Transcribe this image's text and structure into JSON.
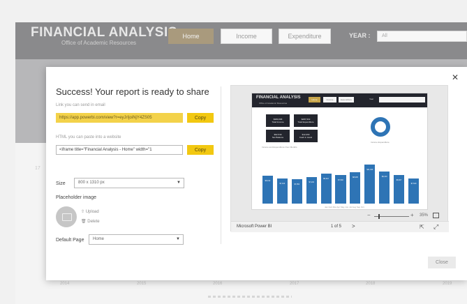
{
  "header": {
    "title": "FINANCIAL ANALYSIS",
    "subtitle": "Office of Academic Resources",
    "tabs": [
      "Home",
      "Income",
      "Expenditure"
    ],
    "year_label": "YEAR :",
    "year_value": "All"
  },
  "background": {
    "ticks": [
      "2014",
      "2015",
      "2016",
      "2017",
      "2018",
      "2019"
    ],
    "axis_label": "17"
  },
  "modal": {
    "title": "Success! Your report is ready to share",
    "link_hint": "Link you can send in email",
    "link_value": "https://app.powerbi.com/view?r=eyJrIjoiNjY4ZS05",
    "copy_label": "Copy",
    "embed_hint": "HTML you can paste into a website",
    "embed_value": "<iframe title=\"Financial Analysis - Home\" width=\"1",
    "size_label": "Size",
    "size_value": "800 x 1310 px",
    "placeholder_label": "Placeholder image",
    "upload_label": "Upload",
    "delete_label": "Delete",
    "default_page_label": "Default Page",
    "default_page_value": "Home",
    "close_label": "Close",
    "close_icon": "close-x"
  },
  "preview": {
    "report_title": "FINANCIAL ANALYSIS",
    "report_subtitle": "Office of Academic Resources",
    "tabs": [
      "Home",
      "Income",
      "Expenditure"
    ],
    "year_label": "Year",
    "kpis": [
      {
        "value": "$380,068",
        "label": "Total Income"
      },
      {
        "value": "$287,519",
        "label": "Total Expenditure"
      },
      {
        "value": "$92,549",
        "label": "Net Balance"
      },
      {
        "value": "$12,063",
        "label": "Cash in Hand"
      }
    ],
    "donut_legend": "Income  Expenditure",
    "line_note": "Income and Expenditure Over Months",
    "axis_note": "Jan  Feb  Mar  Apr  May  Jun  Jul  Aug  Sep  Oct",
    "bars": [
      {
        "label": "$8,192",
        "value": 0.55
      },
      {
        "label": "$7,104",
        "value": 0.5
      },
      {
        "label": "$7,350",
        "value": 0.48
      },
      {
        "label": "$7,210",
        "value": 0.53
      },
      {
        "label": "$8,410",
        "value": 0.6
      },
      {
        "label": "$7,540",
        "value": 0.57
      },
      {
        "label": "$8,905",
        "value": 0.63
      },
      {
        "label": "$11,320",
        "value": 0.78
      },
      {
        "label": "$9,210",
        "value": 0.64
      },
      {
        "label": "$8,007",
        "value": 0.57
      },
      {
        "label": "$7,640",
        "value": 0.5
      }
    ],
    "zoom_pct": "35%",
    "brand": "Microsoft Power BI",
    "page_indicator": "1 of 5",
    "next_glyph": ">",
    "colors": {
      "accent": "#2e74b5",
      "dark": "#23252d",
      "gold": "#c8a64b"
    }
  }
}
